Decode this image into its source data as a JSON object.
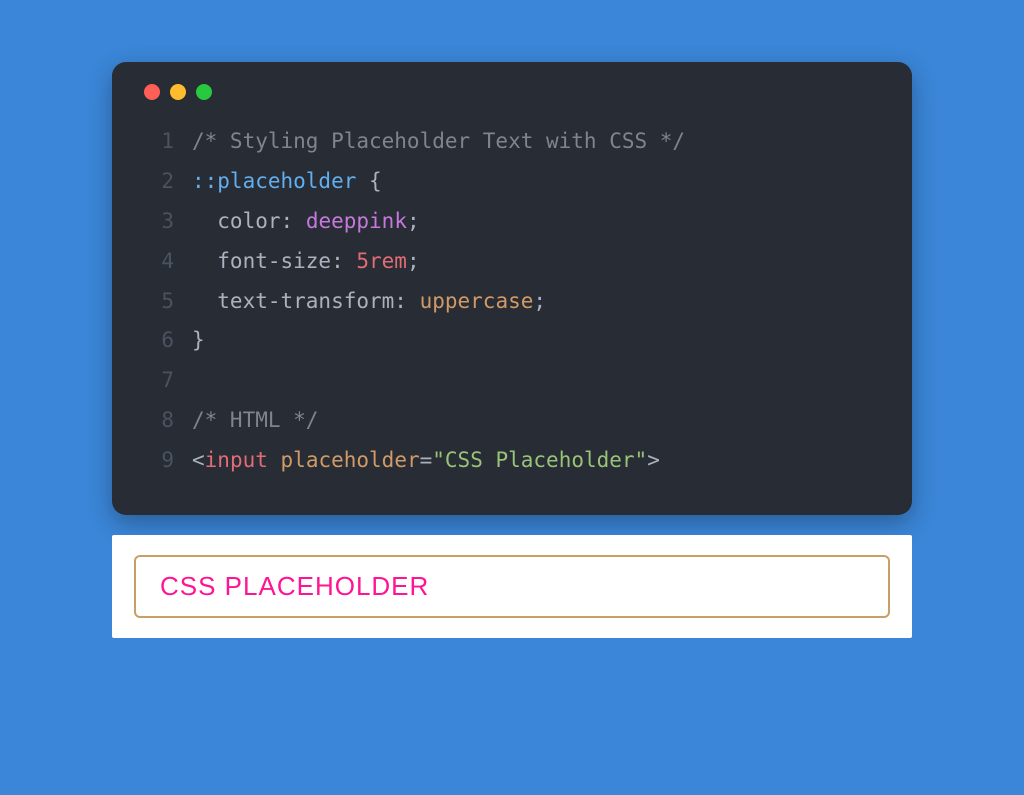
{
  "code": {
    "lines": [
      {
        "num": "1",
        "tokens": [
          {
            "cls": "c-comment",
            "text": "/* Styling Placeholder Text with CSS */"
          }
        ]
      },
      {
        "num": "2",
        "tokens": [
          {
            "cls": "c-selector",
            "text": "::placeholder"
          },
          {
            "cls": "c-punc",
            "text": " {"
          }
        ]
      },
      {
        "num": "3",
        "tokens": [
          {
            "cls": "c-prop",
            "text": "  color"
          },
          {
            "cls": "c-punc",
            "text": ": "
          },
          {
            "cls": "c-valpink",
            "text": "deeppink"
          },
          {
            "cls": "c-punc",
            "text": ";"
          }
        ]
      },
      {
        "num": "4",
        "tokens": [
          {
            "cls": "c-prop",
            "text": "  font-size"
          },
          {
            "cls": "c-punc",
            "text": ": "
          },
          {
            "cls": "c-valnum",
            "text": "5rem"
          },
          {
            "cls": "c-punc",
            "text": ";"
          }
        ]
      },
      {
        "num": "5",
        "tokens": [
          {
            "cls": "c-prop",
            "text": "  text-transform"
          },
          {
            "cls": "c-punc",
            "text": ": "
          },
          {
            "cls": "c-valorng",
            "text": "uppercase"
          },
          {
            "cls": "c-punc",
            "text": ";"
          }
        ]
      },
      {
        "num": "6",
        "tokens": [
          {
            "cls": "c-punc",
            "text": "}"
          }
        ]
      },
      {
        "num": "7",
        "tokens": [
          {
            "cls": "c-punc",
            "text": " "
          }
        ]
      },
      {
        "num": "8",
        "tokens": [
          {
            "cls": "c-comment",
            "text": "/* HTML */"
          }
        ]
      },
      {
        "num": "9",
        "tokens": [
          {
            "cls": "c-angle",
            "text": "<"
          },
          {
            "cls": "c-tag",
            "text": "input"
          },
          {
            "cls": "c-punc",
            "text": " "
          },
          {
            "cls": "c-attr",
            "text": "placeholder"
          },
          {
            "cls": "c-punc",
            "text": "="
          },
          {
            "cls": "c-str",
            "text": "\"CSS Placeholder\""
          },
          {
            "cls": "c-angle",
            "text": ">"
          }
        ]
      }
    ]
  },
  "preview": {
    "placeholder": "CSS Placeholder"
  }
}
